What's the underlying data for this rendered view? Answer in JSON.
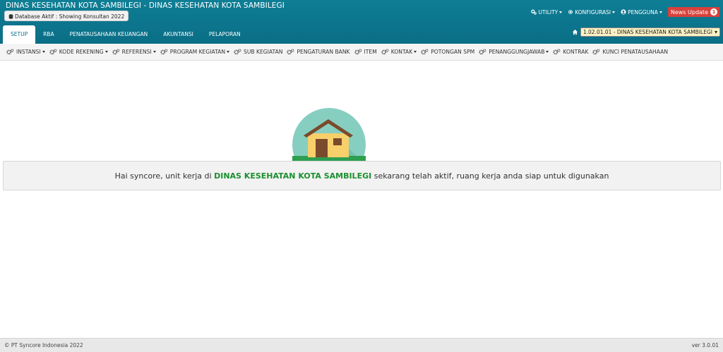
{
  "header": {
    "app_title": "DINAS KESEHATAN KOTA SAMBILEGI - DINAS KESEHATAN KOTA SAMBILEGI",
    "db_badge": "Database Aktif : Showing Konsultan 2022"
  },
  "topnav": {
    "utility": "UTILITY",
    "konfigurasi": "KONFIGURASI",
    "pengguna": "PENGGUNA",
    "news": "News Update",
    "news_count": "1"
  },
  "tabs": [
    {
      "label": "SETUP",
      "active": true
    },
    {
      "label": "RBA"
    },
    {
      "label": "PENATAUSAHAAN KEUANGAN"
    },
    {
      "label": "AKUNTANSI"
    },
    {
      "label": "PELAPORAN"
    }
  ],
  "unit_select": {
    "value": "1.02.01.01 - DINAS KESEHATAN KOTA SAMBILEGI"
  },
  "menubar": [
    {
      "label": "INSTANSI",
      "dropdown": true
    },
    {
      "label": "KODE REKENING",
      "dropdown": true
    },
    {
      "label": "REFERENSI",
      "dropdown": true
    },
    {
      "label": "PROGRAM KEGIATAN",
      "dropdown": true
    },
    {
      "label": "SUB KEGIATAN"
    },
    {
      "label": "PENGATURAN BANK"
    },
    {
      "label": "ITEM"
    },
    {
      "label": "KONTAK",
      "dropdown": true
    },
    {
      "label": "POTONGAN SPM"
    },
    {
      "label": "PENANGGUNGJAWAB",
      "dropdown": true
    },
    {
      "label": "KONTRAK"
    },
    {
      "label": "KUNCI PENATAUSAHAAN"
    }
  ],
  "welcome": {
    "prefix": "Hai syncore, unit kerja di ",
    "unit": "DINAS KESEHATAN KOTA SAMBILEGI",
    "suffix": " sekarang telah aktif, ruang kerja anda siap untuk digunakan"
  },
  "footer": {
    "copyright": "© PT Syncore Indonesia 2022",
    "version": "ver 3.0.01"
  },
  "colors": {
    "header": "#0a6e86",
    "news": "#d9413b",
    "highlight": "#1a8f2e",
    "select_bg": "#fbf3c5"
  }
}
